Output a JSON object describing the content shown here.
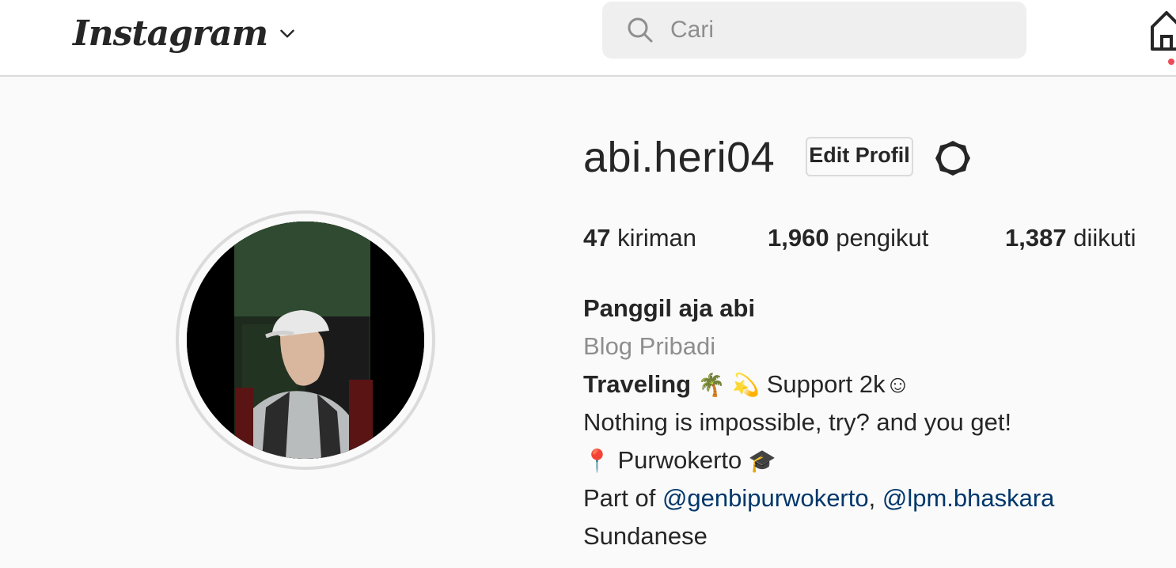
{
  "nav": {
    "logo": "Instagram",
    "search_placeholder": "Cari"
  },
  "profile": {
    "username": "abi.heri04",
    "edit_label": "Edit Profil",
    "stats": [
      {
        "value": "47",
        "label": "kiriman"
      },
      {
        "value": "1,960",
        "label": "pengikut"
      },
      {
        "value": "1,387",
        "label": "diikuti"
      }
    ],
    "full_name": "Panggil aja abi",
    "category": "Blog Pribadi",
    "bio": {
      "line1_bold": "Traveling",
      "line1_emoji1": "🌴",
      "line1_emoji2": "💫",
      "line1_rest": " Support 2k☺",
      "line2": "Nothing is impossible, try? and you get!",
      "line3_pin": "📍",
      "line3_text": " Purwokerto ",
      "line3_cap": "🎓",
      "line4_prefix": "Part of ",
      "mention1": "@genbipurwokerto",
      "sep": ", ",
      "mention2": "@lpm.bhaskara",
      "line5": "Sundanese"
    }
  },
  "icons": {
    "chevron": "chevron-down-icon",
    "search": "search-icon",
    "home": "home-icon",
    "settings": "gear-icon"
  },
  "colors": {
    "background": "#fafafa",
    "text": "#262626",
    "muted": "#8e8e8e",
    "link": "#00376b",
    "notification": "#ed4956",
    "border": "#dbdbdb"
  }
}
